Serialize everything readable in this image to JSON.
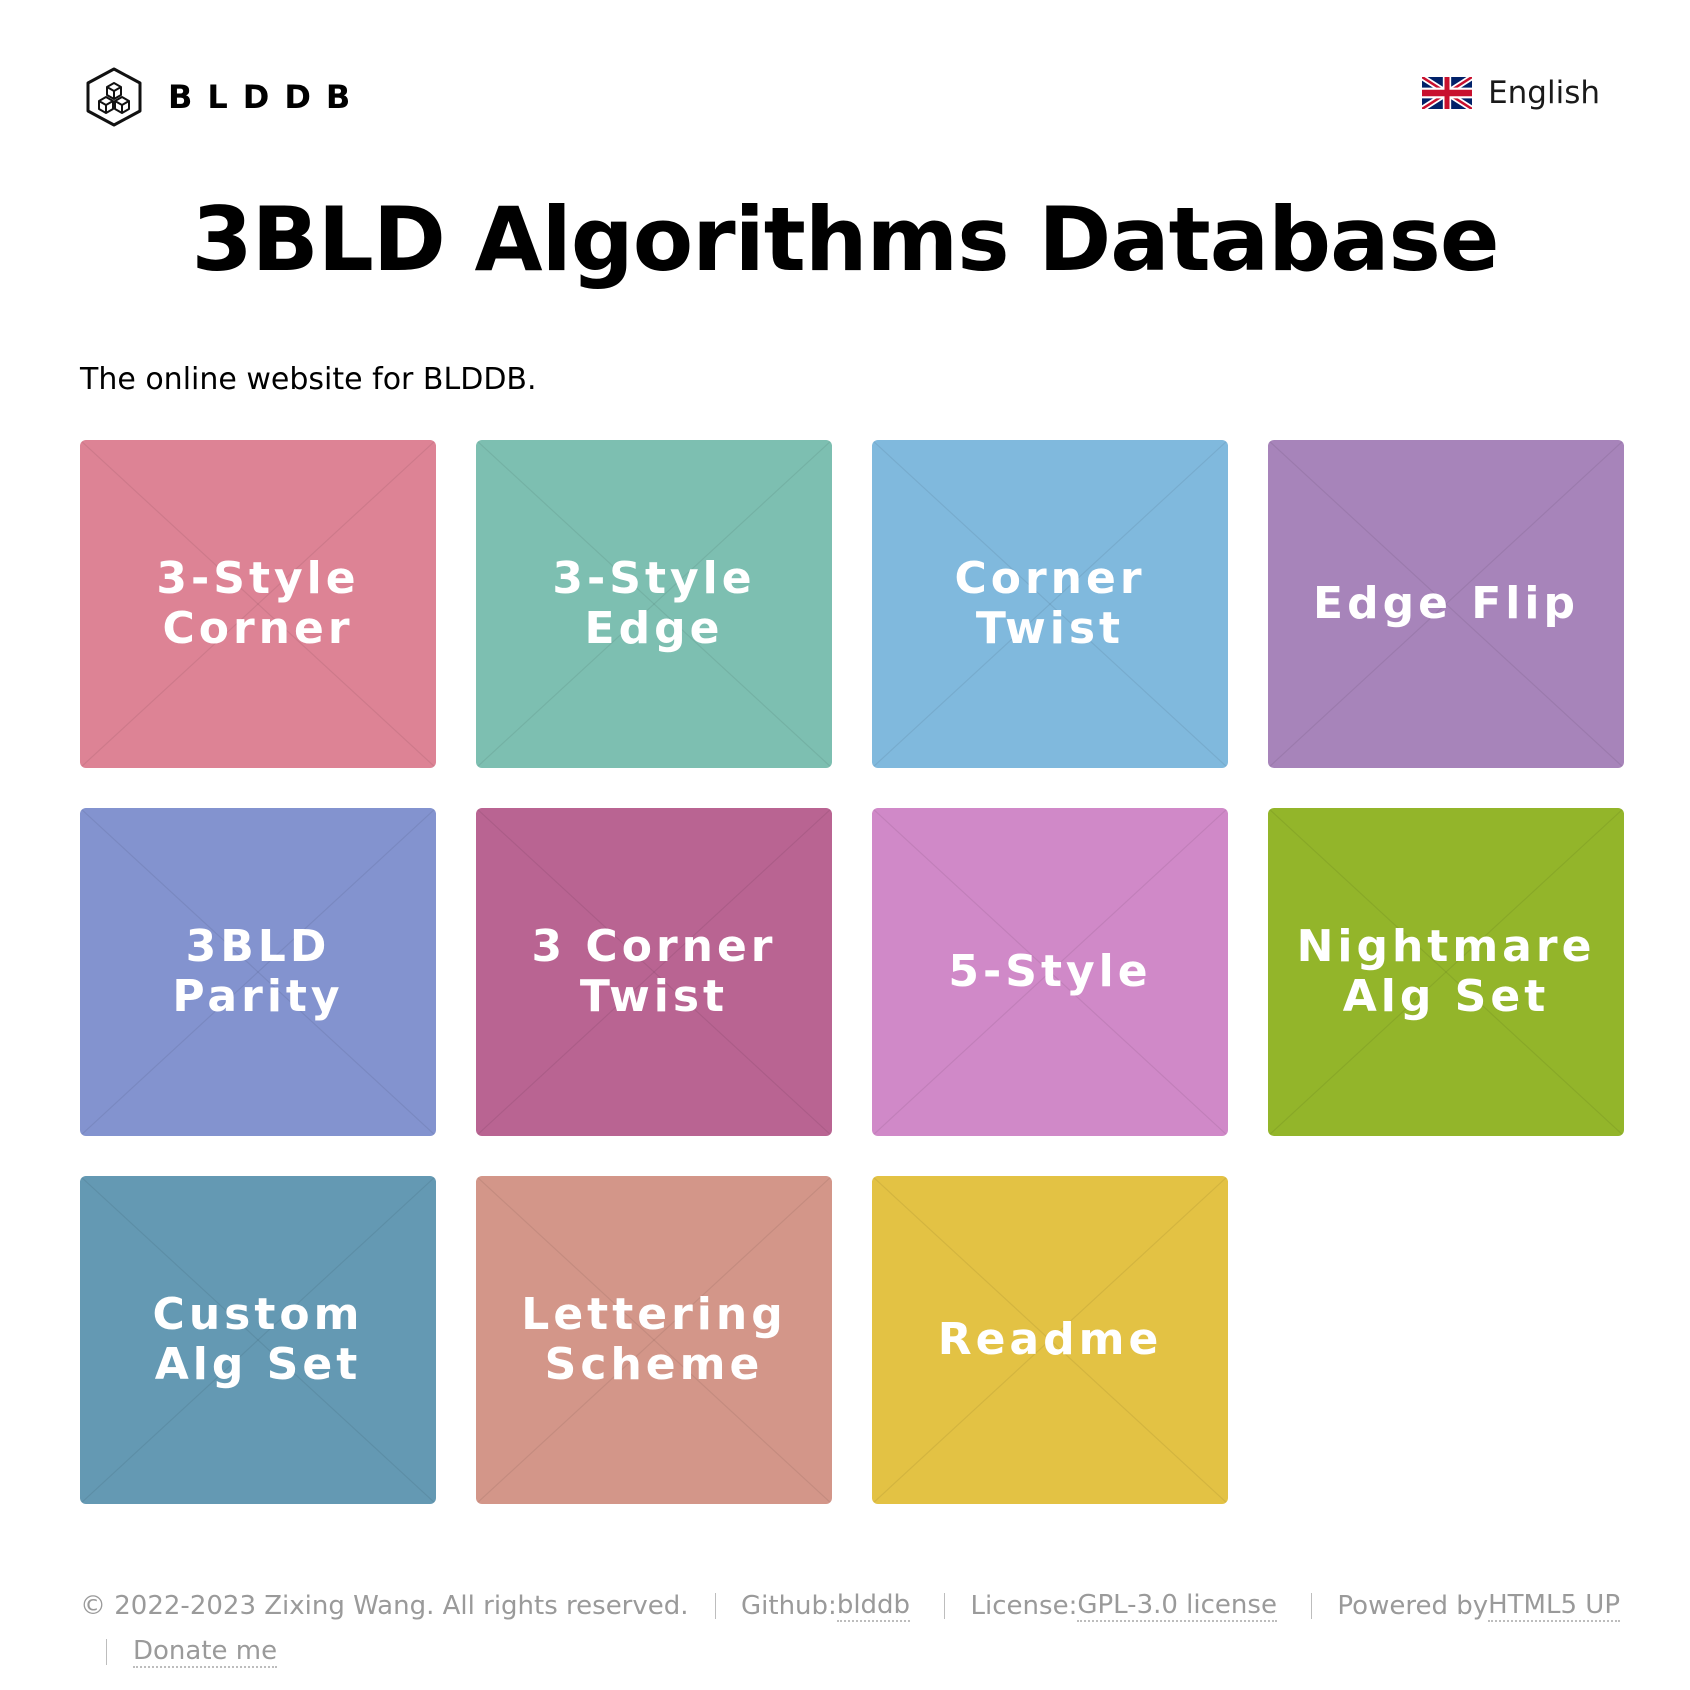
{
  "header": {
    "brand": "BLDDB",
    "language": "English"
  },
  "main": {
    "title": "3BLD Algorithms Database",
    "intro": "The online website for BLDDB."
  },
  "tiles": [
    {
      "label": "3-Style Corner",
      "color": "#dd8395"
    },
    {
      "label": "3-Style Edge",
      "color": "#7dbfb1"
    },
    {
      "label": "Corner Twist",
      "color": "#80b9dd"
    },
    {
      "label": "Edge Flip",
      "color": "#a784ba"
    },
    {
      "label": "3BLD Parity",
      "color": "#8393cf"
    },
    {
      "label": "3 Corner Twist",
      "color": "#b96492"
    },
    {
      "label": "5-Style",
      "color": "#d089c8"
    },
    {
      "label": "Nightmare Alg Set",
      "color": "#93b52a"
    },
    {
      "label": "Custom Alg Set",
      "color": "#6499b3"
    },
    {
      "label": "Lettering Scheme",
      "color": "#d39689"
    },
    {
      "label": "Readme",
      "color": "#e3c244"
    }
  ],
  "footer": {
    "copyright": "© 2022-2023 Zixing Wang. All rights reserved.",
    "github_prefix": "Github: ",
    "github_link": "blddb",
    "license_prefix": "License: ",
    "license_link": "GPL-3.0 license",
    "powered_prefix": "Powered by ",
    "powered_link": "HTML5 UP",
    "donate": "Donate me"
  }
}
